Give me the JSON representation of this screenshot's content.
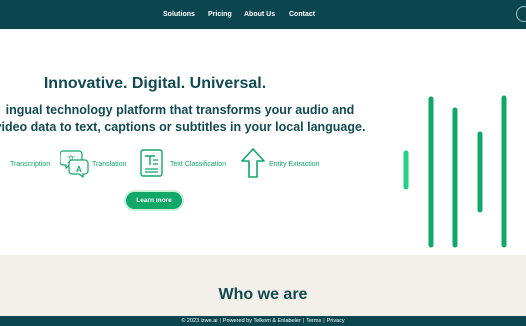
{
  "nav": {
    "items": [
      {
        "label": "Solutions"
      },
      {
        "label": "Pricing"
      },
      {
        "label": "About Us"
      },
      {
        "label": "Contact"
      }
    ]
  },
  "hero": {
    "title": "Innovative. Digital. Universal.",
    "subtitle": "ingual technology platform that transforms your audio and video data to text, captions or subtitles in your local language.",
    "features": [
      {
        "label": "Transcription",
        "icon": "transcription-icon"
      },
      {
        "label": "Translation",
        "icon": "translation-icon"
      },
      {
        "label": "Text Classification",
        "icon": "text-classification-icon"
      },
      {
        "label": "Entity Extraction",
        "icon": "entity-extraction-icon"
      }
    ],
    "cta_label": "Learn more"
  },
  "who": {
    "title": "Who we are"
  },
  "footer": {
    "copyright": "© 2023 izwe.ai",
    "powered": "Powered by Telkom & Enlabeler",
    "terms": "Terms",
    "privacy": "Privacy",
    "separator": "|"
  },
  "colors": {
    "nav_bg": "#0b4650",
    "heading": "#114a52",
    "accent": "#10a768",
    "section_bg": "#f3f0ea"
  }
}
